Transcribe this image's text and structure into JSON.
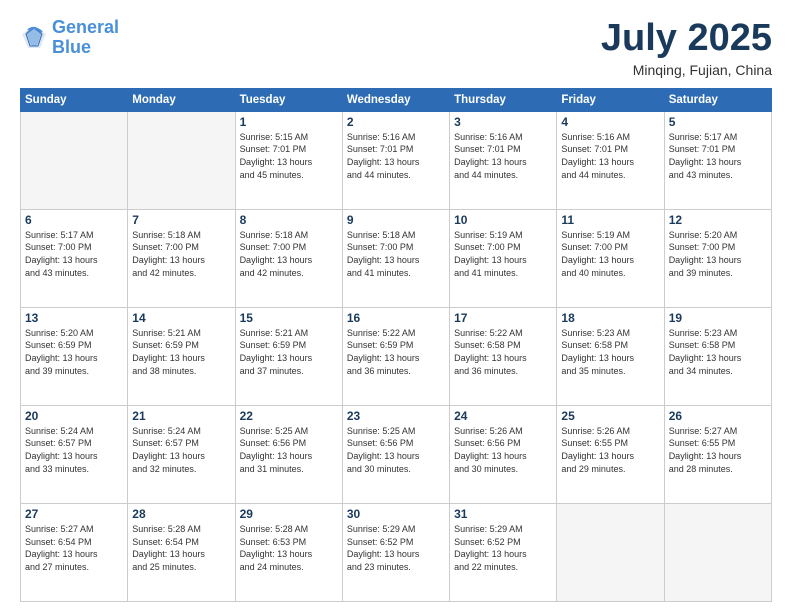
{
  "header": {
    "logo_line1": "General",
    "logo_line2": "Blue",
    "month": "July 2025",
    "location": "Minqing, Fujian, China"
  },
  "weekdays": [
    "Sunday",
    "Monday",
    "Tuesday",
    "Wednesday",
    "Thursday",
    "Friday",
    "Saturday"
  ],
  "weeks": [
    [
      {
        "day": "",
        "info": ""
      },
      {
        "day": "",
        "info": ""
      },
      {
        "day": "1",
        "info": "Sunrise: 5:15 AM\nSunset: 7:01 PM\nDaylight: 13 hours\nand 45 minutes."
      },
      {
        "day": "2",
        "info": "Sunrise: 5:16 AM\nSunset: 7:01 PM\nDaylight: 13 hours\nand 44 minutes."
      },
      {
        "day": "3",
        "info": "Sunrise: 5:16 AM\nSunset: 7:01 PM\nDaylight: 13 hours\nand 44 minutes."
      },
      {
        "day": "4",
        "info": "Sunrise: 5:16 AM\nSunset: 7:01 PM\nDaylight: 13 hours\nand 44 minutes."
      },
      {
        "day": "5",
        "info": "Sunrise: 5:17 AM\nSunset: 7:01 PM\nDaylight: 13 hours\nand 43 minutes."
      }
    ],
    [
      {
        "day": "6",
        "info": "Sunrise: 5:17 AM\nSunset: 7:00 PM\nDaylight: 13 hours\nand 43 minutes."
      },
      {
        "day": "7",
        "info": "Sunrise: 5:18 AM\nSunset: 7:00 PM\nDaylight: 13 hours\nand 42 minutes."
      },
      {
        "day": "8",
        "info": "Sunrise: 5:18 AM\nSunset: 7:00 PM\nDaylight: 13 hours\nand 42 minutes."
      },
      {
        "day": "9",
        "info": "Sunrise: 5:18 AM\nSunset: 7:00 PM\nDaylight: 13 hours\nand 41 minutes."
      },
      {
        "day": "10",
        "info": "Sunrise: 5:19 AM\nSunset: 7:00 PM\nDaylight: 13 hours\nand 41 minutes."
      },
      {
        "day": "11",
        "info": "Sunrise: 5:19 AM\nSunset: 7:00 PM\nDaylight: 13 hours\nand 40 minutes."
      },
      {
        "day": "12",
        "info": "Sunrise: 5:20 AM\nSunset: 7:00 PM\nDaylight: 13 hours\nand 39 minutes."
      }
    ],
    [
      {
        "day": "13",
        "info": "Sunrise: 5:20 AM\nSunset: 6:59 PM\nDaylight: 13 hours\nand 39 minutes."
      },
      {
        "day": "14",
        "info": "Sunrise: 5:21 AM\nSunset: 6:59 PM\nDaylight: 13 hours\nand 38 minutes."
      },
      {
        "day": "15",
        "info": "Sunrise: 5:21 AM\nSunset: 6:59 PM\nDaylight: 13 hours\nand 37 minutes."
      },
      {
        "day": "16",
        "info": "Sunrise: 5:22 AM\nSunset: 6:59 PM\nDaylight: 13 hours\nand 36 minutes."
      },
      {
        "day": "17",
        "info": "Sunrise: 5:22 AM\nSunset: 6:58 PM\nDaylight: 13 hours\nand 36 minutes."
      },
      {
        "day": "18",
        "info": "Sunrise: 5:23 AM\nSunset: 6:58 PM\nDaylight: 13 hours\nand 35 minutes."
      },
      {
        "day": "19",
        "info": "Sunrise: 5:23 AM\nSunset: 6:58 PM\nDaylight: 13 hours\nand 34 minutes."
      }
    ],
    [
      {
        "day": "20",
        "info": "Sunrise: 5:24 AM\nSunset: 6:57 PM\nDaylight: 13 hours\nand 33 minutes."
      },
      {
        "day": "21",
        "info": "Sunrise: 5:24 AM\nSunset: 6:57 PM\nDaylight: 13 hours\nand 32 minutes."
      },
      {
        "day": "22",
        "info": "Sunrise: 5:25 AM\nSunset: 6:56 PM\nDaylight: 13 hours\nand 31 minutes."
      },
      {
        "day": "23",
        "info": "Sunrise: 5:25 AM\nSunset: 6:56 PM\nDaylight: 13 hours\nand 30 minutes."
      },
      {
        "day": "24",
        "info": "Sunrise: 5:26 AM\nSunset: 6:56 PM\nDaylight: 13 hours\nand 30 minutes."
      },
      {
        "day": "25",
        "info": "Sunrise: 5:26 AM\nSunset: 6:55 PM\nDaylight: 13 hours\nand 29 minutes."
      },
      {
        "day": "26",
        "info": "Sunrise: 5:27 AM\nSunset: 6:55 PM\nDaylight: 13 hours\nand 28 minutes."
      }
    ],
    [
      {
        "day": "27",
        "info": "Sunrise: 5:27 AM\nSunset: 6:54 PM\nDaylight: 13 hours\nand 27 minutes."
      },
      {
        "day": "28",
        "info": "Sunrise: 5:28 AM\nSunset: 6:54 PM\nDaylight: 13 hours\nand 25 minutes."
      },
      {
        "day": "29",
        "info": "Sunrise: 5:28 AM\nSunset: 6:53 PM\nDaylight: 13 hours\nand 24 minutes."
      },
      {
        "day": "30",
        "info": "Sunrise: 5:29 AM\nSunset: 6:52 PM\nDaylight: 13 hours\nand 23 minutes."
      },
      {
        "day": "31",
        "info": "Sunrise: 5:29 AM\nSunset: 6:52 PM\nDaylight: 13 hours\nand 22 minutes."
      },
      {
        "day": "",
        "info": ""
      },
      {
        "day": "",
        "info": ""
      }
    ]
  ]
}
